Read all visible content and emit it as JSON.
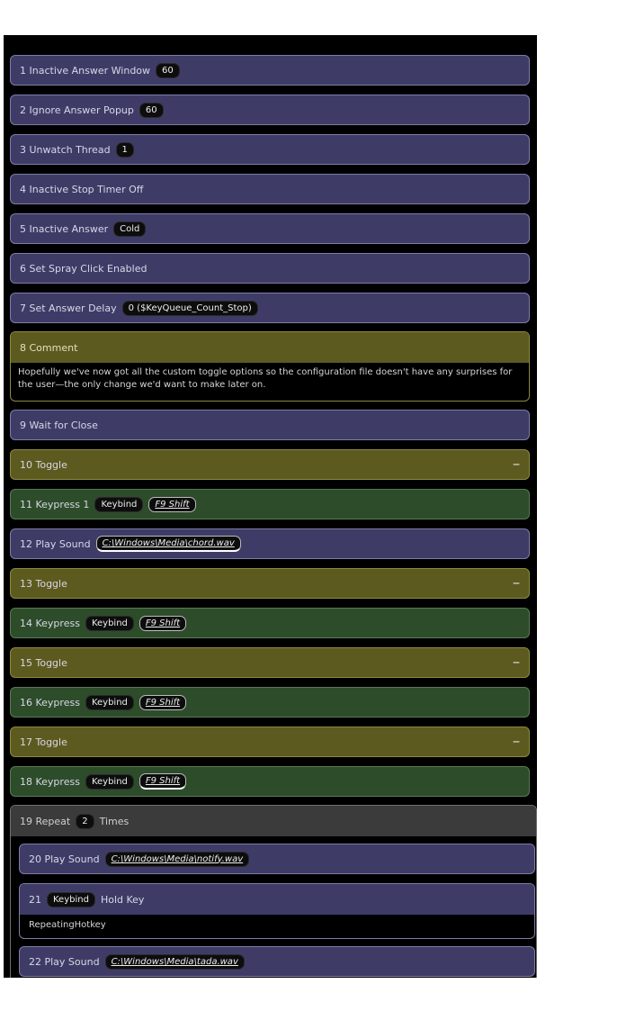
{
  "rows": {
    "r1": {
      "label": "1 Inactive Answer Window",
      "pill": "60"
    },
    "r2": {
      "label": "2 Ignore Answer Popup",
      "pill": "60"
    },
    "r3": {
      "label": "3 Unwatch Thread",
      "pill": "1"
    },
    "r4": {
      "label": "4 Inactive Stop Timer Off"
    },
    "r5": {
      "label": "5 Inactive Answer",
      "pill": "Cold"
    },
    "r6": {
      "label": "6 Set Spray Click Enabled"
    },
    "r7": {
      "label": "7 Set Answer Delay",
      "pill": "0 ($KeyQueue_Count_Stop)"
    },
    "comment": {
      "title": "8 Comment",
      "body": "Hopefully we've now got all the custom toggle options so the configuration file doesn't have any surprises for the user—the only change we'd want to make later on."
    },
    "r9": {
      "label": "9 Wait for Close"
    },
    "r10": {
      "label": "10 Toggle",
      "toggle": "−"
    },
    "r11": {
      "label": "11 Keypress 1",
      "pill1": "Keybind",
      "pill2": "F9 Shift"
    },
    "r12": {
      "label": "12 Play Sound",
      "pill": "C:\\Windows\\Media\\chord.wav"
    },
    "r13": {
      "label": "13 Toggle",
      "toggle": "−"
    },
    "r14": {
      "label": "14 Keypress",
      "pill1": "Keybind",
      "pill2": "F9 Shift"
    },
    "r15": {
      "label": "15 Toggle",
      "toggle": "−"
    },
    "r16": {
      "label": "16 Keypress",
      "pill1": "Keybind",
      "pill2": "F9 Shift"
    },
    "r17": {
      "label": "17 Toggle",
      "toggle": "−"
    },
    "r18": {
      "label": "18 Keypress",
      "pill1": "Keybind",
      "pill2": "F9 Shift"
    },
    "group": {
      "label": "19 Repeat",
      "pill": "2",
      "suffix": "Times",
      "c1": {
        "label": "20 Play Sound",
        "pill": "C:\\Windows\\Media\\notify.wav"
      },
      "c2": {
        "prefix": "21",
        "pill": "Keybind",
        "label": "Hold Key",
        "body": "RepeatingHotkey"
      },
      "c3": {
        "label": "22 Play Sound",
        "pill": "C:\\Windows\\Media\\tada.wav"
      }
    }
  }
}
